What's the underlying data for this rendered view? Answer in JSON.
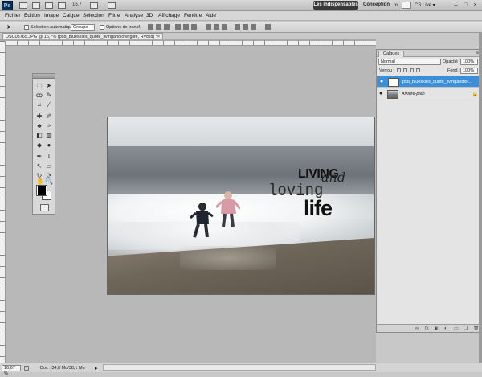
{
  "app": {
    "logo_text": "Ps",
    "zoom": "16,7",
    "workspace_essentials": "Les indispensables",
    "workspace_design": "Conception",
    "more_chevron": "»",
    "cslive": "CS Live ▾"
  },
  "menu": [
    "Fichier",
    "Edition",
    "Image",
    "Calque",
    "Sélection",
    "Filtre",
    "Analyse",
    "3D",
    "Affichage",
    "Fenêtre",
    "Aide"
  ],
  "options": {
    "auto_select_label": "Sélection automatique :",
    "auto_select_value": "Groupe",
    "transform_label": "Options de transf."
  },
  "document": {
    "tab_title": "DSC03765.JPG @ 16,7% (psd_blueskies_quote_livingandlovinglife, RVB/8) *",
    "close": "×"
  },
  "quote": {
    "line1": "LIVING",
    "line2": "and",
    "line3": "loving",
    "line4": "life"
  },
  "layers_panel": {
    "tab_label": "Calques",
    "blend_mode": "Normal",
    "opacity_label": "Opacité :",
    "opacity_value": "100%",
    "lock_label": "Verrou :",
    "fill_label": "Fond :",
    "fill_value": "100%",
    "layers": [
      {
        "name": "psd_blueskies_quote_livingandlo...",
        "selected": true
      },
      {
        "name": "Arrière-plan",
        "selected": false
      }
    ]
  },
  "status": {
    "zoom": "16,67 %",
    "doc_info": "Doc : 34,8 Mo/38,1 Mo"
  },
  "colors": {
    "selection": "#3b8fd8",
    "foreground": "#000000",
    "background": "#ffffff"
  }
}
